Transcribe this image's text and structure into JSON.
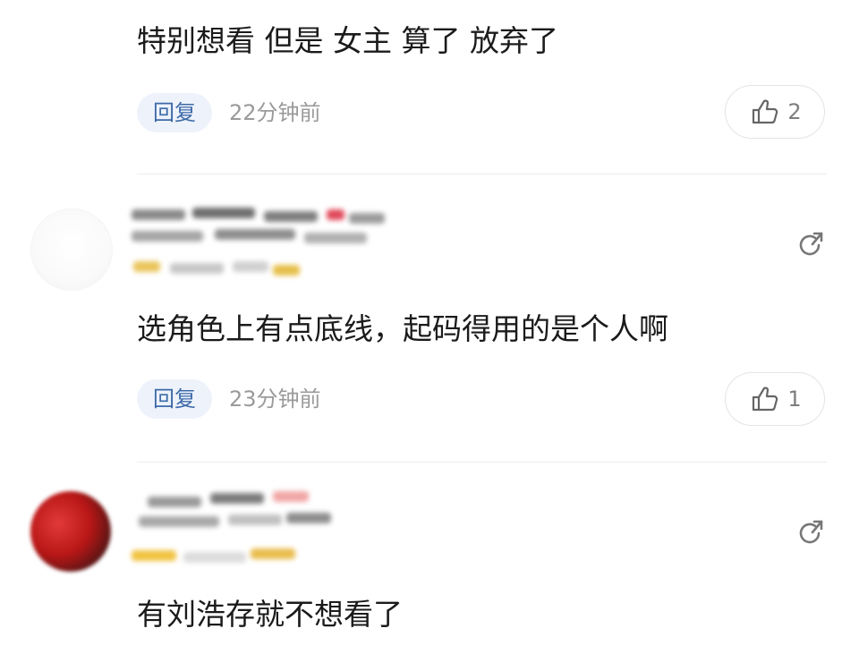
{
  "comments": [
    {
      "text": "特别想看  但是  女主  算了  放弃了",
      "reply_label": "回复",
      "time": "22分钟前",
      "likes": "2"
    },
    {
      "text": "选角色上有点底线，起码得用的是个人啊",
      "reply_label": "回复",
      "time": "23分钟前",
      "likes": "1"
    },
    {
      "text": "有刘浩存就不想看了"
    }
  ],
  "icons": {
    "like": "thumbs-up-icon",
    "share": "share-icon"
  },
  "colors": {
    "reply_bg": "#eef3fb",
    "reply_text": "#3d6aa8",
    "time_text": "#9a9a9a"
  }
}
